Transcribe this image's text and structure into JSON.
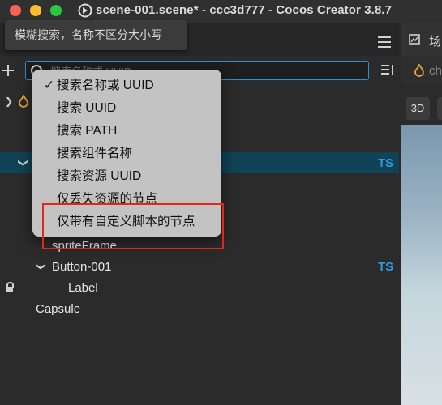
{
  "window": {
    "title": "scene-001.scene* - ccc3d777 - Cocos Creator 3.8.7"
  },
  "tooltip": {
    "text": "模糊搜索，名称不区分大小写"
  },
  "search": {
    "placeholder": "搜索名称或 UUID",
    "value": ""
  },
  "dropdown": {
    "items": [
      {
        "label": "搜索名称或 UUID",
        "checked": "✓"
      },
      {
        "label": "搜索 UUID",
        "checked": ""
      },
      {
        "label": "搜索 PATH",
        "checked": ""
      },
      {
        "label": "搜索组件名称",
        "checked": ""
      },
      {
        "label": "搜索资源 UUID",
        "checked": ""
      },
      {
        "label": "仅丢失资源的节点",
        "checked": ""
      },
      {
        "label": "仅带有自定义脚本的节点",
        "checked": ""
      }
    ]
  },
  "tree": {
    "ts_label": "TS",
    "rows": [
      {
        "label": "spriteFrame"
      },
      {
        "label": "Button-001"
      },
      {
        "label": "Label"
      },
      {
        "label": "Capsule"
      }
    ]
  },
  "right_panel": {
    "tab_label": "场",
    "row2_label": "ch",
    "btn_3d": "3D"
  },
  "colors": {
    "selection": "#104356",
    "accent": "#2d9bdc",
    "highlight_border": "#e0261f"
  }
}
